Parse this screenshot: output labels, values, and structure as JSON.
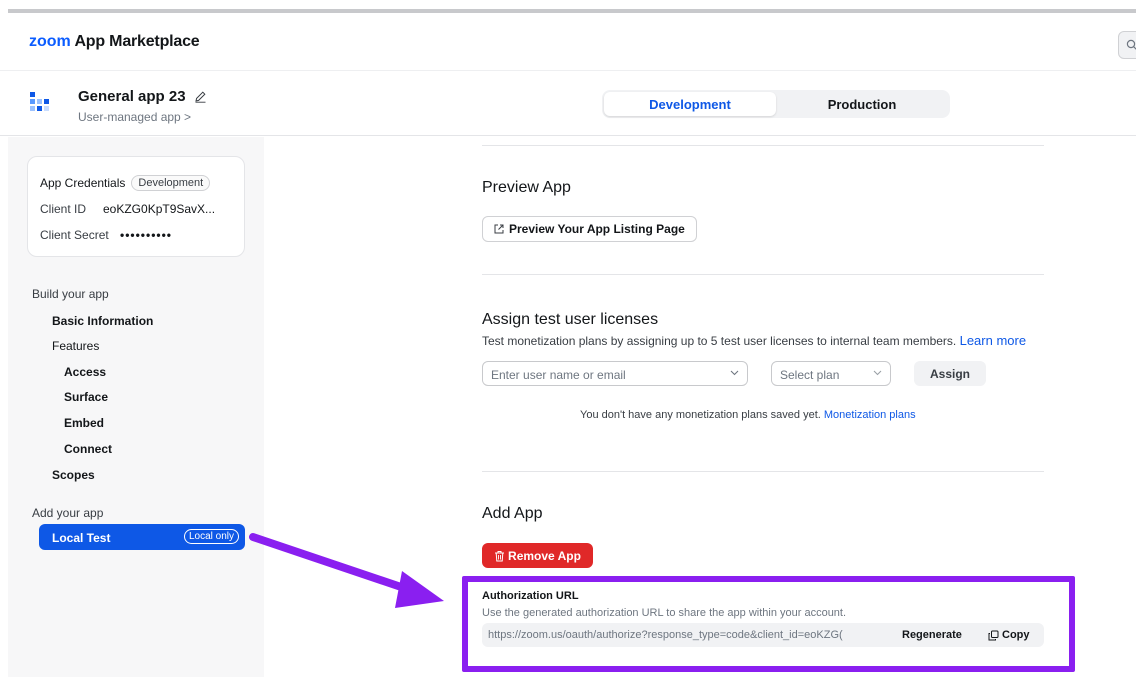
{
  "header": {
    "logo_brand": "zoom",
    "logo_text": "App Marketplace"
  },
  "app": {
    "name": "General app 23",
    "type": "User-managed app >",
    "tabs": [
      {
        "label": "Development",
        "active": true
      },
      {
        "label": "Production",
        "active": false
      }
    ]
  },
  "credentials": {
    "title": "App Credentials",
    "badge": "Development",
    "client_id_label": "Client ID",
    "client_id_value": "eoKZG0KpT9SavX...",
    "client_secret_label": "Client Secret",
    "client_secret_value": "••••••••••"
  },
  "sidebar": {
    "build_label": "Build your app",
    "items": [
      {
        "label": "Basic Information"
      },
      {
        "label": "Features"
      },
      {
        "label": "Access"
      },
      {
        "label": "Surface"
      },
      {
        "label": "Embed"
      },
      {
        "label": "Connect"
      },
      {
        "label": "Scopes"
      }
    ],
    "add_label": "Add your app",
    "local_test_label": "Local Test",
    "local_test_badge": "Local only"
  },
  "preview": {
    "heading": "Preview App",
    "button_label": "Preview Your App Listing Page"
  },
  "licenses": {
    "heading": "Assign test user licenses",
    "description": "Test monetization plans by assigning up to 5 test user licenses to internal team members.",
    "learn_more": "Learn more",
    "user_placeholder": "Enter user name or email",
    "plan_placeholder": "Select plan",
    "assign_label": "Assign",
    "note_text": "You don't have any monetization plans saved yet.",
    "note_link": "Monetization plans"
  },
  "add_app": {
    "heading": "Add App",
    "remove_label": "Remove App",
    "auth_title": "Authorization URL",
    "auth_desc": "Use the generated authorization URL to share the app within your account.",
    "auth_url": "https://zoom.us/oauth/authorize?response_type=code&client_id=eoKZG(",
    "regenerate_label": "Regenerate",
    "copy_label": "Copy"
  },
  "colors": {
    "accent": "#0e58e6",
    "danger": "#e02828",
    "annotation": "#8a1ff0"
  }
}
